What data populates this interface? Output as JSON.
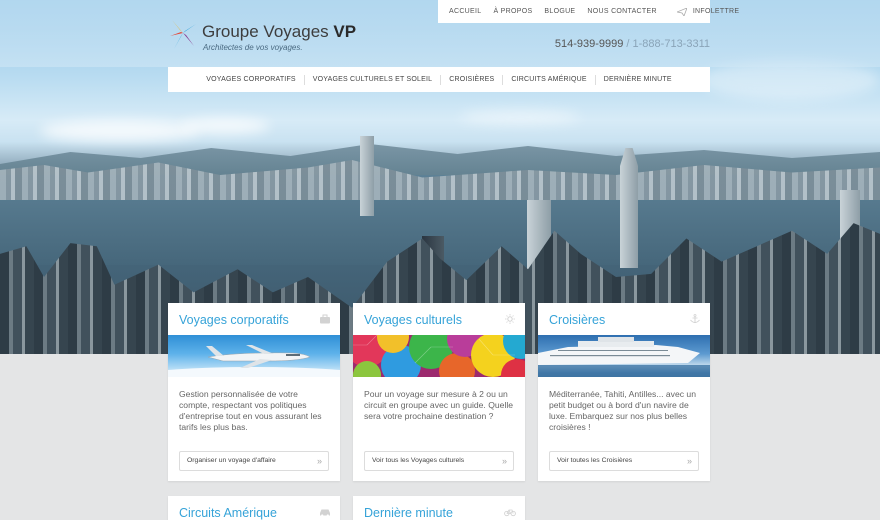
{
  "brand": {
    "name_light": "Groupe Voyages ",
    "name_bold": "VP",
    "tagline": "Architectes de vos voyages.",
    "logo_colors": [
      "#f4b31b",
      "#2aa0d8",
      "#8a3b92",
      "#e24a3b"
    ]
  },
  "topnav": {
    "items": [
      "ACCUEIL",
      "À PROPOS",
      "BLOGUE",
      "NOUS CONTACTER"
    ],
    "newsletter": "INFOLETTRE",
    "newsletter_icon": "paper-plane-icon"
  },
  "contact": {
    "phone_local": "514-939-9999",
    "separator": " / ",
    "phone_tollfree": "1-888-713-3311"
  },
  "mainnav": {
    "items": [
      "VOYAGES CORPORATIFS",
      "VOYAGES CULTURELS ET SOLEIL",
      "CROISIÈRES",
      "CIRCUITS AMÉRIQUE",
      "DERNIÈRE MINUTE"
    ]
  },
  "cards": [
    {
      "title": "Voyages corporatifs",
      "icon": "briefcase-icon",
      "text": "Gestion personnalisée de votre compte, respectant vos politiques d'entreprise tout en vous assurant les tarifs les plus bas.",
      "button": "Organiser un voyage d'affaire"
    },
    {
      "title": "Voyages culturels",
      "icon": "sun-icon",
      "text": "Pour un voyage sur mesure à 2 ou un circuit en groupe avec un guide. Quelle sera votre prochaine destination ?",
      "button": "Voir tous les Voyages culturels"
    },
    {
      "title": "Croisières",
      "icon": "anchor-icon",
      "text": "Méditerranée, Tahiti, Antilles... avec un petit budget ou à bord d'un navire de luxe. Embarquez sur nos plus belles croisières !",
      "button": "Voir toutes les Croisières"
    },
    {
      "title": "Circuits Amérique",
      "icon": "car-icon"
    },
    {
      "title": "Dernière minute",
      "icon": "bicycle-icon"
    }
  ],
  "colors": {
    "accent": "#36a3d8",
    "page_bg": "#e4e5e6"
  }
}
